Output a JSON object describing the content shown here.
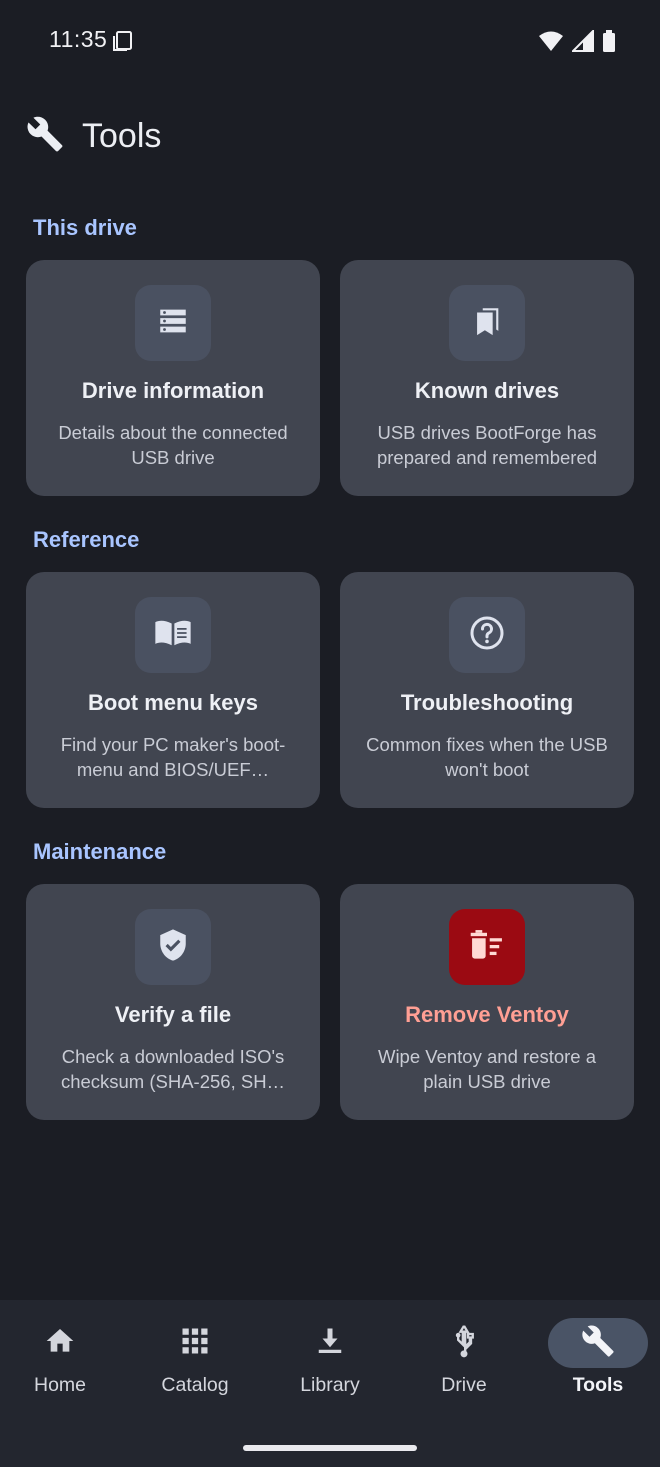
{
  "status": {
    "time": "11:35",
    "icons": [
      "sim-card-icon",
      "wifi-icon",
      "signal-icon",
      "battery-icon"
    ]
  },
  "header": {
    "title": "Tools",
    "icon": "wrench-icon"
  },
  "sections": [
    {
      "label": "This drive",
      "cards": [
        {
          "title": "Drive information",
          "desc": "Details about the connected USB drive",
          "icon": "storage-list-icon"
        },
        {
          "title": "Known drives",
          "desc": "USB drives BootForge has prepared and remembered",
          "icon": "bookmarks-icon"
        }
      ]
    },
    {
      "label": "Reference",
      "cards": [
        {
          "title": "Boot menu keys",
          "desc": "Find your PC maker's boot-menu and BIOS/UEF…",
          "icon": "open-book-icon"
        },
        {
          "title": "Troubleshooting",
          "desc": "Common fixes when the USB won't boot",
          "icon": "help-circle-icon"
        }
      ]
    },
    {
      "label": "Maintenance",
      "cards": [
        {
          "title": "Verify a file",
          "desc": "Check a downloaded ISO's checksum (SHA-256, SH…",
          "icon": "shield-check-icon"
        },
        {
          "title": "Remove Ventoy",
          "desc": "Wipe Ventoy and restore a plain USB drive",
          "icon": "delete-sweep-icon"
        }
      ]
    }
  ],
  "nav": [
    {
      "label": "Home",
      "icon": "home-icon"
    },
    {
      "label": "Catalog",
      "icon": "grid-icon"
    },
    {
      "label": "Library",
      "icon": "download-icon"
    },
    {
      "label": "Drive",
      "icon": "usb-icon"
    },
    {
      "label": "Tools",
      "icon": "wrench-icon",
      "active": true
    }
  ],
  "colors": {
    "background": "#1b1d24",
    "card": "#414550",
    "section_label": "#a9c5ff",
    "danger_bg": "#9b0a12",
    "danger_text": "#ff9f94",
    "nav_bg": "#23262f",
    "nav_active_pill": "#4a5466"
  }
}
